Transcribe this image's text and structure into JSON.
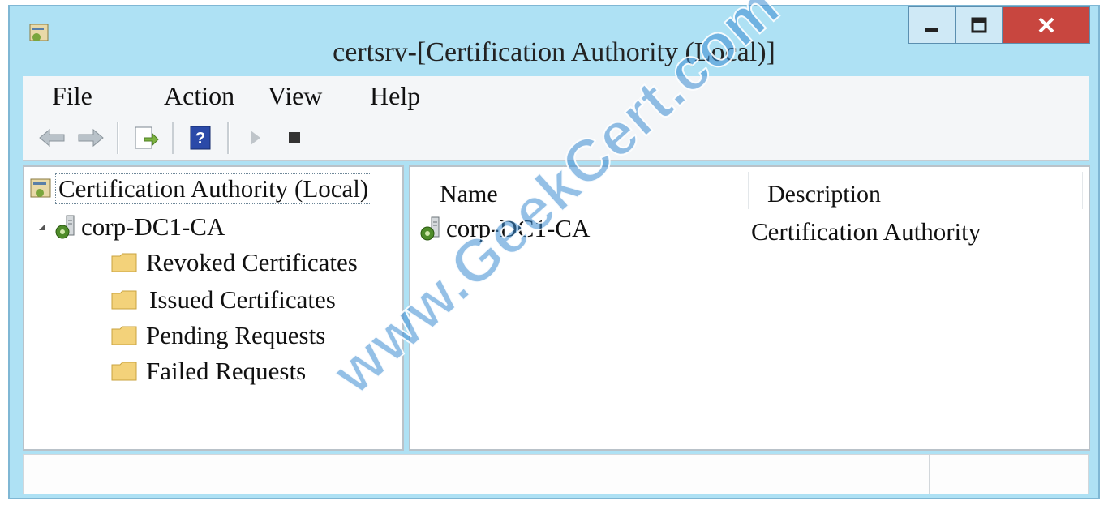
{
  "window": {
    "title": "certsrv-[Certification Authority (Local)]",
    "controls": {
      "minimize": "–",
      "maximize": "□",
      "close": "x"
    }
  },
  "menu": [
    "File",
    "Action",
    "View",
    "Help"
  ],
  "toolbar": {
    "icons": [
      "back-arrow-icon",
      "forward-arrow-icon",
      "export-list-icon",
      "help-icon",
      "start-service-icon",
      "stop-service-icon"
    ]
  },
  "tree": {
    "root": "Certification Authority (Local)",
    "ca": "corp-DC1-CA",
    "children": [
      "Revoked Certificates",
      "Issued Certificates",
      "Pending Requests",
      "Failed Requests"
    ]
  },
  "list": {
    "columns": [
      "Name",
      "Description"
    ],
    "rows": [
      {
        "name": "corp-DC1-CA",
        "description": "Certification Authority"
      }
    ]
  },
  "watermark": "www.GeekCert.com",
  "colors": {
    "window_frame": "#aee1f4",
    "close_button": "#c8463f",
    "folder": "#f3d27a"
  }
}
